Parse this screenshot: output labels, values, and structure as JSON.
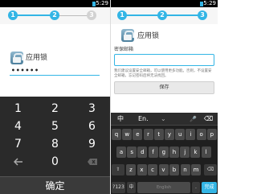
{
  "status": {
    "time": "5:29"
  },
  "left": {
    "steps": [
      "1",
      "2",
      "3"
    ],
    "app_name": "应用锁",
    "pin_value": "••••••",
    "keypad": [
      "1",
      "2",
      "3",
      "4",
      "5",
      "6",
      "7",
      "8",
      "9",
      "0"
    ],
    "confirm_label": "确定"
  },
  "right": {
    "steps": [
      "1",
      "2",
      "3"
    ],
    "app_name": "应用锁",
    "email_label": "密保邮箱",
    "hint": "我们建议设置安全邮箱，可以使用更多功能。否则，不设置安全邮箱，忘记密码后将无法找回。",
    "save_label": "保存",
    "kb_top": {
      "chinese": "中",
      "english": "En.",
      "mic": "🎤",
      "delete": "⌫"
    },
    "kb_rows": [
      [
        "q",
        "w",
        "e",
        "r",
        "t",
        "y",
        "u",
        "i",
        "o",
        "p"
      ],
      [
        "a",
        "s",
        "d",
        "f",
        "g",
        "h",
        "j",
        "k",
        "l"
      ],
      [
        "z",
        "x",
        "c",
        "v",
        "b",
        "n",
        "m"
      ]
    ],
    "kb_bottom": {
      "num": "?123",
      "lang": "中",
      "space": "English",
      "period": ".",
      "done": "完成"
    }
  }
}
